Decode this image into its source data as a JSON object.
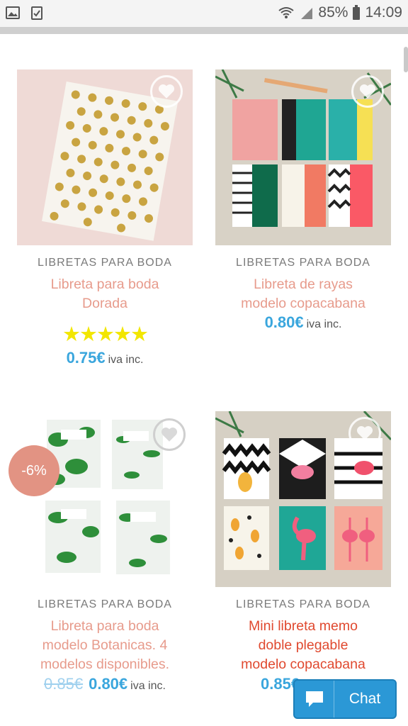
{
  "status_bar": {
    "battery": "85%",
    "time": "14:09",
    "icons": [
      "image-icon",
      "clipboard-check-icon",
      "wifi-icon",
      "signal-icon",
      "battery-icon"
    ]
  },
  "products": [
    {
      "category": "LIBRETAS PARA BODA",
      "title_line1": "Libreta para boda",
      "title_line2": "Dorada",
      "rating_stars": "★★★★★",
      "rating": 5,
      "price": "0.75€",
      "tax_note": "iva inc."
    },
    {
      "category": "LIBRETAS PARA BODA",
      "title_line1": "Libreta de rayas",
      "title_line2": "modelo copacabana",
      "price": "0.80€",
      "tax_note": "iva inc."
    },
    {
      "category": "LIBRETAS PARA BODA",
      "title_line1": "Libreta para boda",
      "title_line2": "modelo Botanicas. 4",
      "title_line3": "modelos disponibles.",
      "old_price": "0.85€",
      "price": "0.80€",
      "tax_note": "iva inc.",
      "discount": "-6%"
    },
    {
      "category": "LIBRETAS PARA BODA",
      "title_line1": "Mini libreta memo",
      "title_line2": "doble plegable",
      "title_line3": "modelo copacabana",
      "price": "0.85€"
    }
  ],
  "chat": {
    "label": "Chat",
    "icon": "chat-bubble-icon"
  },
  "colors": {
    "title": "#e79b8c",
    "title_active": "#e0492f",
    "price": "#3aa6dd",
    "stars": "#f2e600",
    "discount_badge": "#e29383",
    "chat_button": "#2b98d6"
  }
}
